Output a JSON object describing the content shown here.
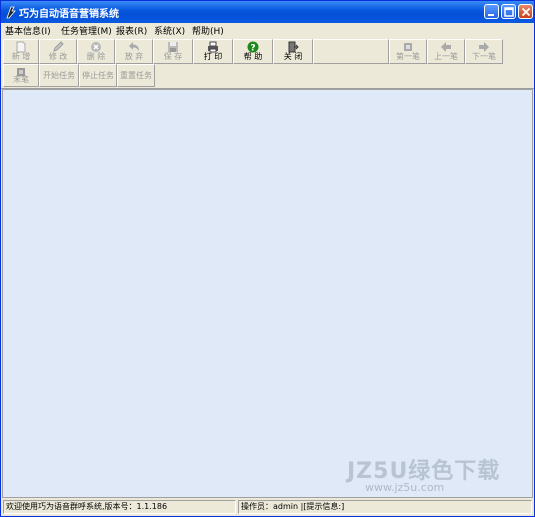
{
  "window": {
    "title": "巧为自动语音营销系统"
  },
  "menu": [
    {
      "label": "基本信息(I)"
    },
    {
      "label": "任务管理(M)"
    },
    {
      "label": "报表(R)"
    },
    {
      "label": "系统(X)"
    },
    {
      "label": "帮助(H)"
    }
  ],
  "toolbar": {
    "row1": [
      {
        "label": "新 增",
        "icon": "new-doc-icon",
        "enabled": false
      },
      {
        "label": "修 改",
        "icon": "pencil-icon",
        "enabled": false
      },
      {
        "label": "删 除",
        "icon": "delete-icon",
        "enabled": false
      },
      {
        "label": "放 弃",
        "icon": "undo-icon",
        "enabled": false
      },
      {
        "label": "保 存",
        "icon": "save-icon",
        "enabled": false
      },
      {
        "label": "打 印",
        "icon": "printer-icon",
        "enabled": true
      },
      {
        "label": "帮 助",
        "icon": "help-icon",
        "enabled": true
      },
      {
        "label": "关 闭",
        "icon": "exit-door-icon",
        "enabled": true
      },
      {
        "label": "第一笔",
        "icon": "first-record-icon",
        "enabled": false
      },
      {
        "label": "上一笔",
        "icon": "prev-arrow-icon",
        "enabled": false
      },
      {
        "label": "下一笔",
        "icon": "next-arrow-icon",
        "enabled": false
      }
    ],
    "row2": [
      {
        "label": "末笔",
        "icon": "last-record-icon",
        "enabled": false
      },
      {
        "label": "开始任务",
        "enabled": false
      },
      {
        "label": "停止任务",
        "enabled": false
      },
      {
        "label": "重置任务",
        "enabled": false
      }
    ]
  },
  "watermark": {
    "line1": "JZ5U绿色下载",
    "line2": "www.jz5u.com"
  },
  "status": {
    "welcome": "欢迎使用巧为语音群呼系统,版本号：1.1.186",
    "operator": "操作员：admin |[提示信息:]"
  },
  "colors": {
    "titlebar": "#0a5ae0",
    "chrome": "#ece9d8",
    "client": "#dfe9f7",
    "help_green": "#1a8a1a"
  }
}
